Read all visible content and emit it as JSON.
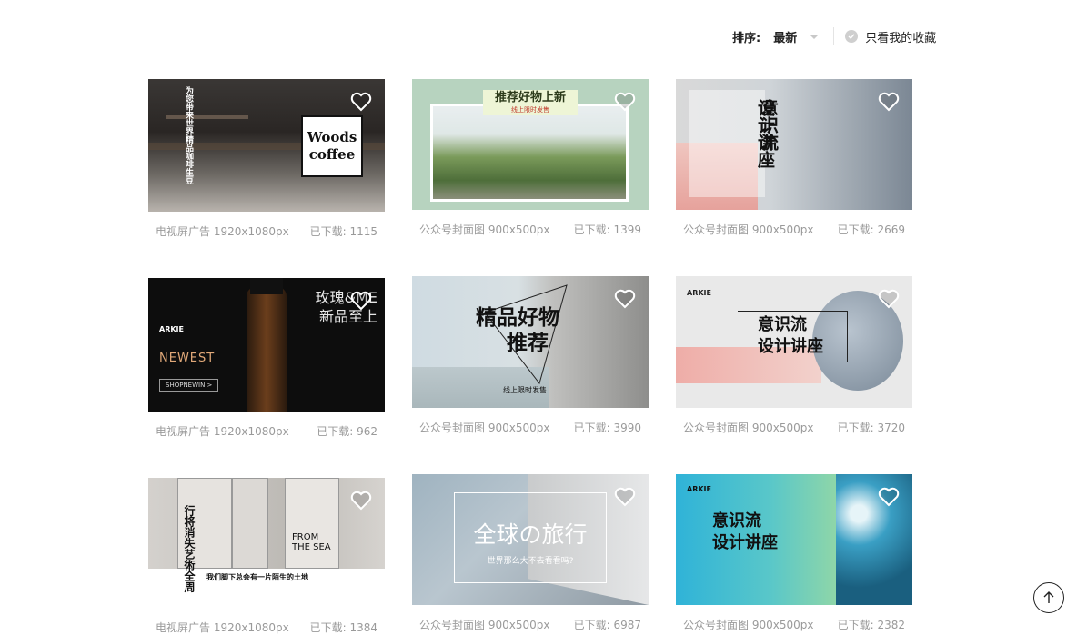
{
  "toolbar": {
    "sort_label": "排序:",
    "sort_value": "最新",
    "favorites_filter": "只看我的收藏"
  },
  "cards": [
    {
      "type": "电视屏广告 1920x1080px",
      "downloads": "已下载: 1115",
      "title": "Woods coffee",
      "subtitle": "为您带来世界精品咖啡生豆"
    },
    {
      "type": "公众号封面图 900x500px",
      "downloads": "已下载: 1399",
      "title": "推荐好物上新",
      "subtitle": "线上限时发售"
    },
    {
      "type": "公众号封面图 900x500px",
      "downloads": "已下载: 2669",
      "title": "设计讲座",
      "title2": "意识流"
    },
    {
      "type": "电视屏广告 1920x1080px",
      "downloads": "已下载: 962",
      "title": "玫瑰&ME",
      "title2": "新品至上",
      "tag": "NEWEST",
      "button": "SHOPNEWIN >",
      "brand": "ARKIE"
    },
    {
      "type": "公众号封面图 900x500px",
      "downloads": "已下载: 3990",
      "title": "精品好物",
      "title2": "推荐",
      "subtitle": "线上限时发售"
    },
    {
      "type": "公众号封面图 900x500px",
      "downloads": "已下载: 3720",
      "title": "意识流",
      "title2": "设计讲座",
      "brand": "ARKIE"
    },
    {
      "type": "电视屏广告 1920x1080px",
      "downloads": "已下载: 1384",
      "title": "我们脚下总会有一片陌生的土地",
      "subtitle": "行将消失艺術全周",
      "sign": "FROM THE SEA"
    },
    {
      "type": "公众号封面图 900x500px",
      "downloads": "已下载: 6987",
      "title": "全球の旅行",
      "subtitle": "世界那么大不去看看吗?"
    },
    {
      "type": "公众号封面图 900x500px",
      "downloads": "已下载: 2382",
      "title": "意识流",
      "title2": "设计讲座",
      "brand": "ARKIE"
    }
  ],
  "colors": {
    "accent": "#222222",
    "meta_text": "#9a9a9a"
  },
  "icons": {
    "favorite": "heart-icon",
    "back_to_top": "arrow-up-icon",
    "filter_check": "check-circle-icon"
  }
}
